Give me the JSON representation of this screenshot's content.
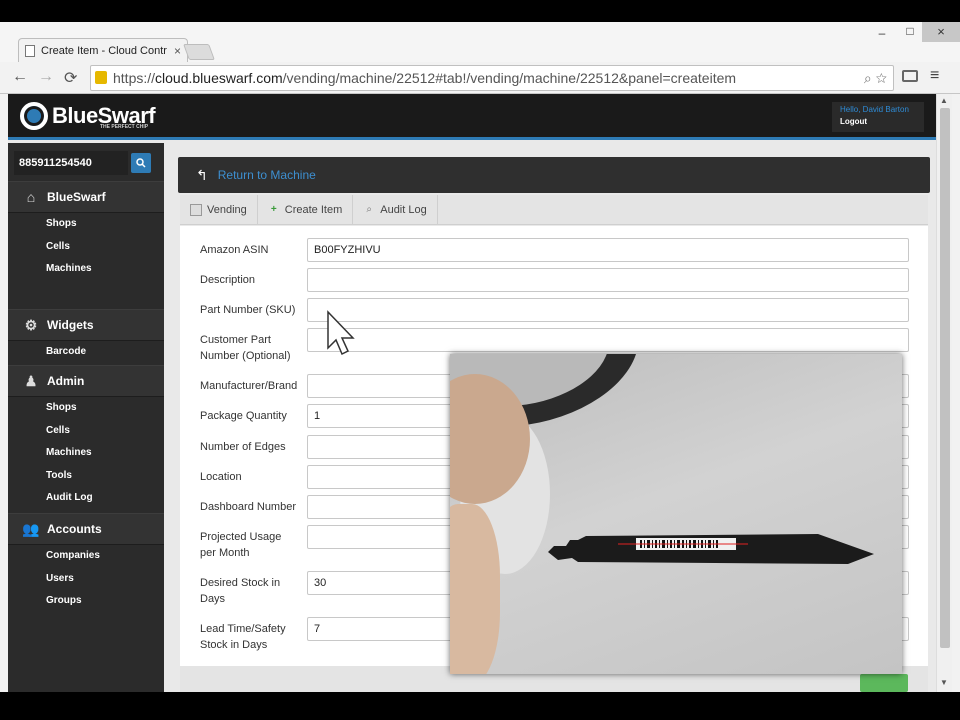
{
  "browser": {
    "tab_title": "Create Item - Cloud Contr",
    "tab_close": "×",
    "url_scheme": "https://",
    "url_host": "cloud.blueswarf.com",
    "url_path": "/vending/machine/22512#tab!/vending/machine/22512&panel=createitem",
    "window_controls": {
      "minimize": "–",
      "maximize": "□",
      "close": "×"
    },
    "nav": {
      "back": "←",
      "forward": "→",
      "reload": "⟳"
    },
    "omni_icons": "⌕ ☆",
    "menu": "≡"
  },
  "app": {
    "logo_text": "BlueSwarf",
    "tagline": "THE PERFECT CHIP",
    "user": {
      "hello": "Hello, David Barton",
      "logout": "Logout"
    },
    "accent": "#2e7bb5"
  },
  "sidebar": {
    "scan_value": "885911254540",
    "search_icon": "🔍",
    "sections": [
      {
        "label": "BlueSwarf",
        "icon": "⌂",
        "items": [
          "Shops",
          "Cells",
          "Machines"
        ]
      },
      {
        "label": "Widgets",
        "icon": "⚙",
        "items": [
          "Barcode"
        ]
      },
      {
        "label": "Admin",
        "icon": "♟",
        "items": [
          "Shops",
          "Cells",
          "Machines",
          "Tools",
          "Audit Log"
        ]
      },
      {
        "label": "Accounts",
        "icon": "👥",
        "items": [
          "Companies",
          "Users",
          "Groups"
        ]
      }
    ]
  },
  "main": {
    "return_icon": "↰",
    "return_label": "Return to Machine",
    "tabs": [
      {
        "label": "Vending",
        "icon": ""
      },
      {
        "label": "Create Item",
        "icon": "+"
      },
      {
        "label": "Audit Log",
        "icon": "⌕"
      }
    ],
    "fields": [
      {
        "label": "Amazon ASIN",
        "value": "B00FYZHIVU"
      },
      {
        "label": "Description",
        "value": ""
      },
      {
        "label": "Part Number (SKU)",
        "value": ""
      },
      {
        "label": "Customer Part Number (Optional)",
        "value": ""
      },
      {
        "label": "Manufacturer/Brand",
        "value": ""
      },
      {
        "label": "Package Quantity",
        "value": "1"
      },
      {
        "label": "Number of Edges",
        "value": ""
      },
      {
        "label": "Location",
        "value": ""
      },
      {
        "label": "Dashboard Number",
        "value": ""
      },
      {
        "label": "Projected Usage per Month",
        "value": ""
      },
      {
        "label": "Desired Stock in Days",
        "value": "30"
      },
      {
        "label": "Lead Time/Safety Stock in Days",
        "value": "7"
      }
    ]
  },
  "scrollbar": {
    "up": "▲",
    "down": "▼"
  }
}
